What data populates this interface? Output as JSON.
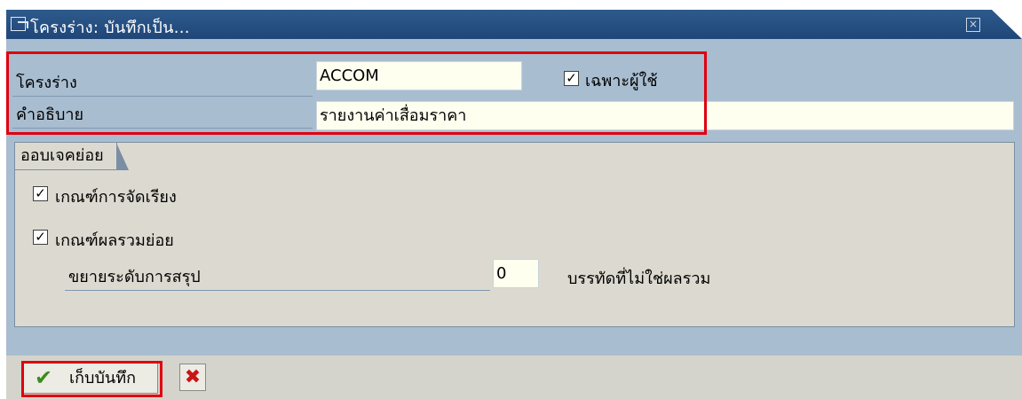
{
  "window": {
    "title": "โครงร่าง: บันทึกเป็น..."
  },
  "form": {
    "layout_label": "โครงร่าง",
    "layout_value": "ACCOM",
    "user_specific_label": "เฉพาะผู้ใช้",
    "user_specific_checked": true,
    "description_label": "คำอธิบาย",
    "description_value": "รายงานค่าเสื่อมราคา"
  },
  "subobjects": {
    "title": "ออบเจคย่อย",
    "sort_criteria_label": "เกณฑ์การจัดเรียง",
    "sort_criteria_checked": true,
    "subtotal_criteria_label": "เกณฑ์ผลรวมย่อย",
    "subtotal_criteria_checked": true,
    "expand_level_label": "ขยายระดับการสรุป",
    "expand_level_value": "0",
    "non_total_rows_label": "บรรทัดที่ไม่ใช่ผลรวม"
  },
  "toolbar": {
    "save_label": "เก็บบันทึก",
    "save_icon": "checkmark-icon",
    "cancel_icon": "cross-icon"
  },
  "colors": {
    "highlight": "#e0000f",
    "titlebar": "#2f5a8c",
    "input_bg": "#fffff0"
  }
}
